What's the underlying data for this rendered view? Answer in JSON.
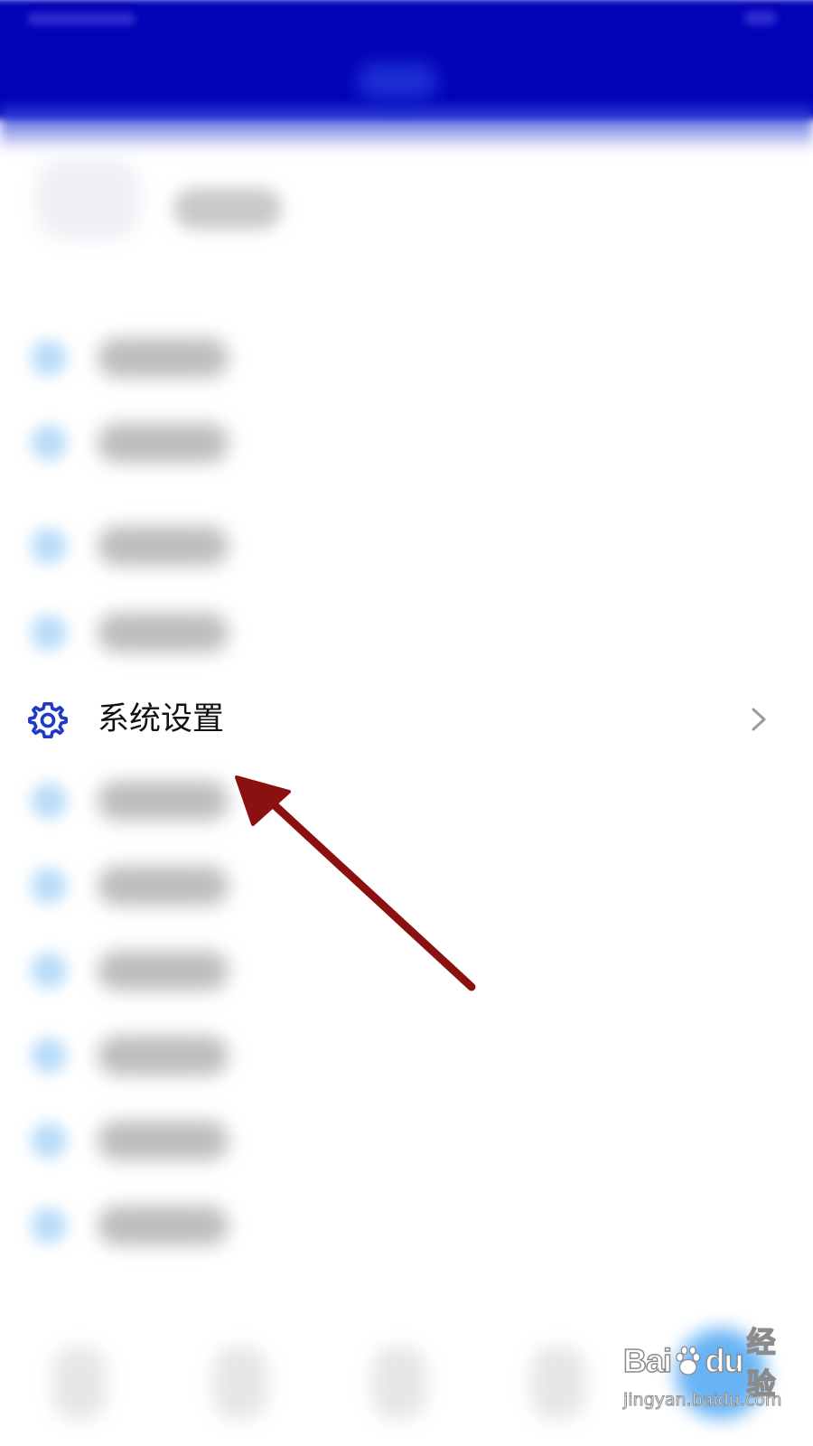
{
  "menu": {
    "settings_label": "系统设置",
    "blurred_row_count": 10
  },
  "watermark": {
    "logo_part1": "Bai",
    "logo_part2": "du",
    "logo_part3": "经验",
    "url": "jingyan.baidu.com"
  },
  "colors": {
    "header": "#0303b8",
    "gear_icon": "#1f39c8",
    "annotation_arrow": "#8b1111",
    "blurred_icon": "#b9dcf9"
  }
}
